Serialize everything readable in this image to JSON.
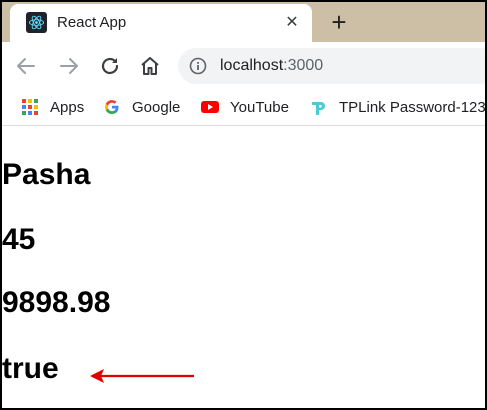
{
  "tab": {
    "title": "React App",
    "close": "✕",
    "favicon": "react-logo-icon"
  },
  "new_tab": "+",
  "toolbar": {
    "back": "back-arrow-icon",
    "forward": "forward-arrow-icon",
    "reload": "reload-icon",
    "home": "home-icon",
    "url_host": "localhost",
    "url_port": ":3000"
  },
  "bookmarks": [
    {
      "label": "Apps",
      "icon": "apps-grid-icon"
    },
    {
      "label": "Google",
      "icon": "google-logo-icon"
    },
    {
      "label": "YouTube",
      "icon": "youtube-logo-icon"
    },
    {
      "label": "TPLink Password-123",
      "icon": "tplink-logo-icon"
    }
  ],
  "content": {
    "values": [
      "Pasha",
      "45",
      "9898.98",
      "true"
    ]
  },
  "colors": {
    "tab_strip": "#cdbfa5",
    "arrow": "#e00000",
    "text": "#000000"
  }
}
